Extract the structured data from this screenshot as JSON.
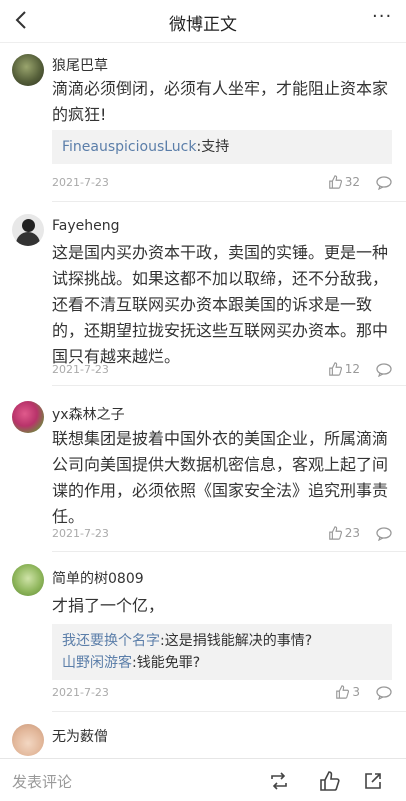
{
  "header": {
    "title": "微博正文",
    "more": "···"
  },
  "comments": [
    {
      "user": "狼尾巴草",
      "text": "滴滴必须倒闭，必须有人坐牢，才能阻止资本家的疯狂!",
      "replies": [
        {
          "name": "FineauspiciousLuck",
          "text": ":支持"
        }
      ],
      "date": "2021-7-23",
      "likes": "32"
    },
    {
      "user": "Fayeheng",
      "text": "这是国内买办资本干政，卖国的实锤。更是一种试探挑战。如果这都不加以取缔，还不分敌我，还看不清互联网买办资本跟美国的诉求是一致的，还期望拉拢安抚这些互联网买办资本。那中国只有越来越烂。",
      "replies": [],
      "date": "2021-7-23",
      "likes": "12"
    },
    {
      "user": "yx森林之子",
      "text": "联想集团是披着中国外衣的美国企业，所属滴滴公司向美国提供大数据机密信息，客观上起了间谍的作用，必须依照《国家安全法》追究刑事责任。",
      "replies": [],
      "date": "2021-7-23",
      "likes": "23"
    },
    {
      "user": "简单的树0809",
      "text": "才捐了一个亿，",
      "replies": [
        {
          "name": "我还要换个名字",
          "text": ":这是捐钱能解决的事情?"
        },
        {
          "name": "山野闲游客",
          "text": ":钱能免罪?"
        }
      ],
      "date": "2021-7-23",
      "likes": "3"
    },
    {
      "user": "无为薮僧",
      "text": "",
      "replies": [],
      "date": "",
      "likes": ""
    }
  ],
  "footer": {
    "placeholder": "发表评论"
  },
  "colors": {
    "link": "#5b7ea9",
    "muted": "#aaaaaa",
    "reply_bg": "#f2f2f2"
  }
}
